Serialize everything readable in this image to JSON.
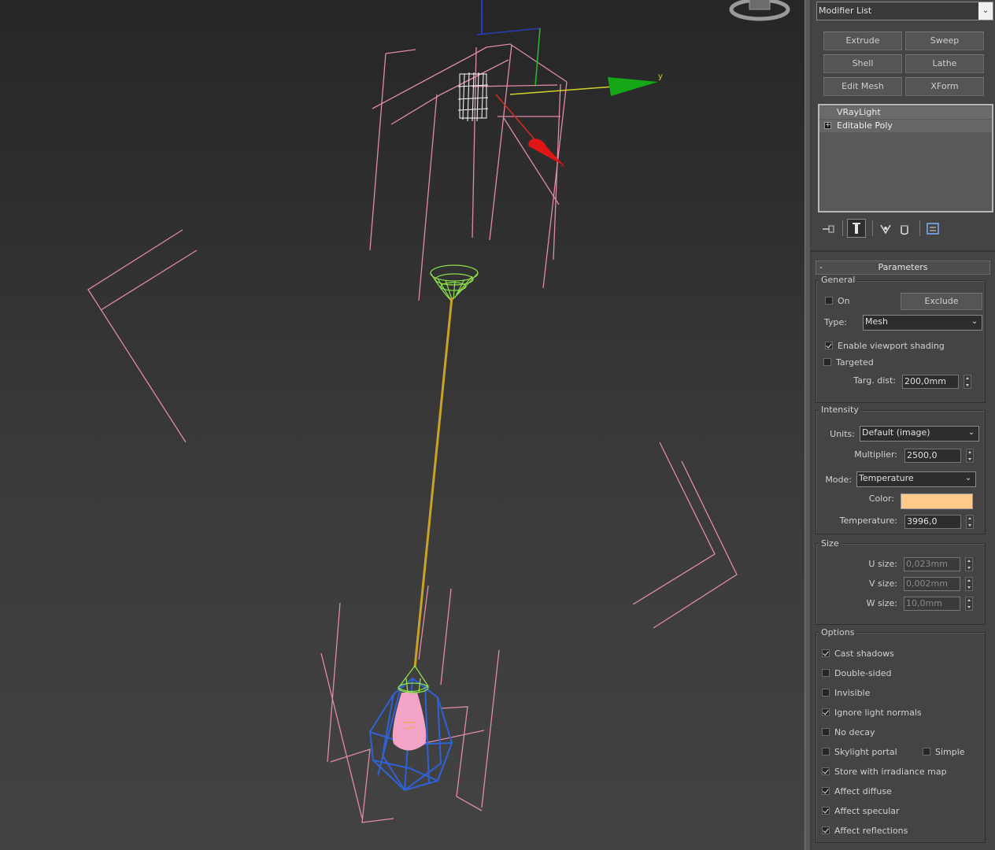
{
  "modifier_list": {
    "label": "Modifier List"
  },
  "modifier_buttons": [
    "Extrude",
    "Sweep",
    "Shell",
    "Lathe",
    "Edit Mesh",
    "XForm"
  ],
  "stack": {
    "items": [
      {
        "label": "VRayLight"
      },
      {
        "label": "Editable Poly"
      }
    ]
  },
  "rollout": {
    "title": "Parameters",
    "collapse_symbol": "-"
  },
  "general": {
    "title": "General",
    "on_label": "On",
    "on_checked": false,
    "exclude_label": "Exclude",
    "type_label": "Type:",
    "type_value": "Mesh",
    "enable_viewport_shading_label": "Enable viewport shading",
    "enable_viewport_shading_checked": true,
    "targeted_label": "Targeted",
    "targeted_checked": false,
    "targ_dist_label": "Targ. dist:",
    "targ_dist_value": "200,0mm"
  },
  "intensity": {
    "title": "Intensity",
    "units_label": "Units:",
    "units_value": "Default (image)",
    "multiplier_label": "Multiplier:",
    "multiplier_value": "2500,0",
    "mode_label": "Mode:",
    "mode_value": "Temperature",
    "color_label": "Color:",
    "color_swatch": "#ffc98a",
    "temperature_label": "Temperature:",
    "temperature_value": "3996,0"
  },
  "size": {
    "title": "Size",
    "u_label": "U size:",
    "u_value": "0,023mm",
    "v_label": "V size:",
    "v_value": "0,002mm",
    "w_label": "W size:",
    "w_value": "10,0mm"
  },
  "options": {
    "title": "Options",
    "items": [
      {
        "label": "Cast shadows",
        "checked": true
      },
      {
        "label": "Double-sided",
        "checked": false
      },
      {
        "label": "Invisible",
        "checked": false
      },
      {
        "label": "Ignore light normals",
        "checked": true
      },
      {
        "label": "No decay",
        "checked": false
      },
      {
        "label": "Skylight portal",
        "checked": false
      },
      {
        "label": "Store with irradiance map",
        "checked": true
      },
      {
        "label": "Affect diffuse",
        "checked": true
      },
      {
        "label": "Affect specular",
        "checked": true
      },
      {
        "label": "Affect reflections",
        "checked": true
      }
    ],
    "simple_label": "Simple",
    "simple_checked": false
  },
  "gizmo": {
    "y_axis_label": "y",
    "x_axis_label": "x"
  },
  "colors": {
    "wire_pink": "#e28aa9",
    "wire_blue": "#2f62d6",
    "wire_green": "#8de04a",
    "cord": "#c9a227",
    "bulb": "#f3a4c6"
  }
}
